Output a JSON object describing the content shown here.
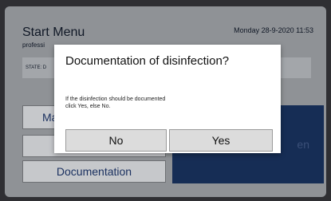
{
  "app": {
    "title": "Start Menu",
    "subtitle": "professi",
    "datetime": "Monday 28-9-2020 11:53",
    "state_label": "STATE: D"
  },
  "buttons": {
    "main": "Ma",
    "documentation": "Documentation",
    "big_right_fragment": "en"
  },
  "dialog": {
    "title": "Documentation of disinfection?",
    "message_line1": "If the disinfection should be documented",
    "message_line2": "click Yes, else No.",
    "no_label": "No",
    "yes_label": "Yes"
  },
  "colors": {
    "accent_dark_blue": "#162d55",
    "dialog_bg": "#ffffff",
    "screen_bg": "#8f9296"
  }
}
